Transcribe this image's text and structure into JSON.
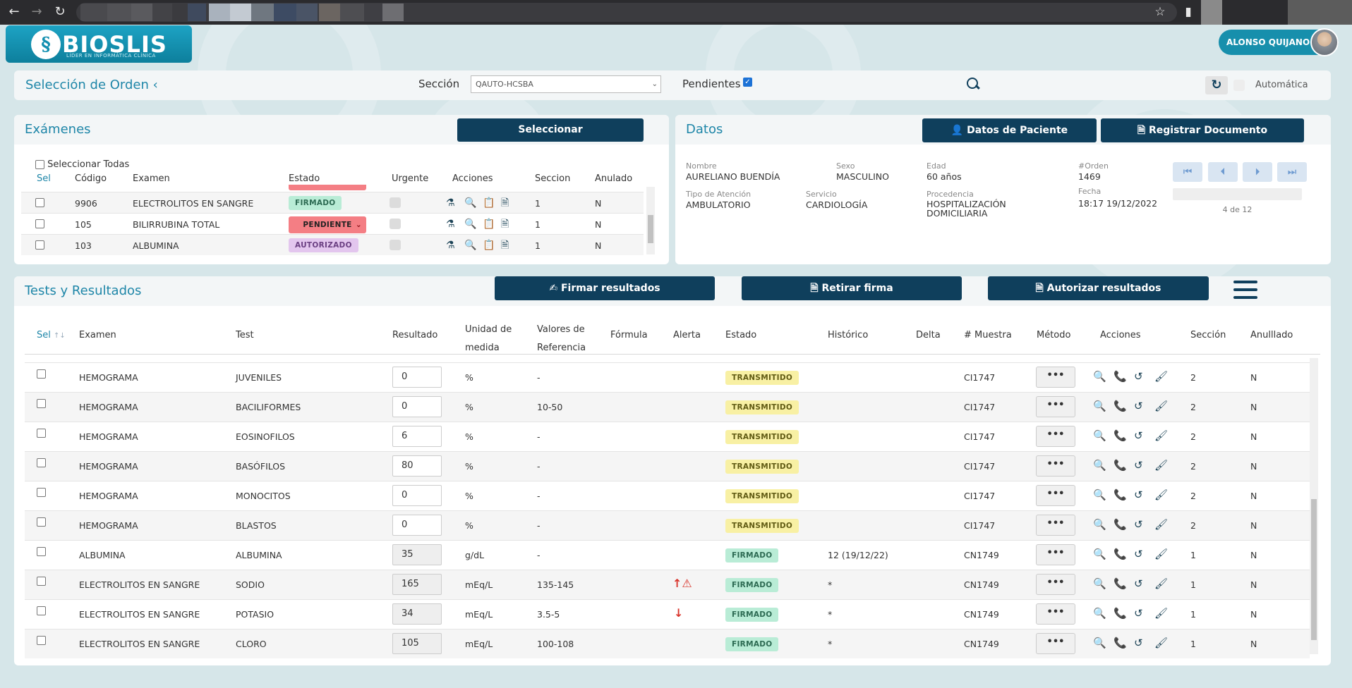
{
  "browser": {
    "back": "←",
    "forward": "→",
    "reload": "↻",
    "star": "☆",
    "sidepanel": "▮"
  },
  "header": {
    "logo_name": "BIOSLIS",
    "logo_tagline": "LÍDER EN INFORMÁTICA CLÍNICA",
    "user_name": "ALONSO QUIJANO"
  },
  "order_bar": {
    "title": "Selección de Orden",
    "section_label": "Sección",
    "section_value": "QAUTO-HCSBA",
    "pending_label": "Pendientes",
    "automatic_label": "Automática"
  },
  "exams": {
    "title": "Exámenes",
    "select_button": "Seleccionar",
    "select_all": "Seleccionar Todas",
    "columns": [
      "Sel",
      "Código",
      "Examen",
      "Estado",
      "Urgente",
      "Acciones",
      "Seccion",
      "Anulado"
    ],
    "rows": [
      {
        "codigo": "9906",
        "examen": "ELECTROLITOS EN SANGRE",
        "estado": "FIRMADO",
        "seccion": "1",
        "anulado": "N"
      },
      {
        "codigo": "105",
        "examen": "BILIRRUBINA TOTAL",
        "estado": "PENDIENTE",
        "seccion": "1",
        "anulado": "N"
      },
      {
        "codigo": "103",
        "examen": "ALBUMINA",
        "estado": "AUTORIZADO",
        "seccion": "1",
        "anulado": "N"
      }
    ]
  },
  "datos": {
    "title": "Datos",
    "patient_button": "Datos de Paciente",
    "register_button": "Registrar Documento",
    "nombre_label": "Nombre",
    "nombre": "AURELIANO BUENDÍA",
    "sexo_label": "Sexo",
    "sexo": "MASCULINO",
    "edad_label": "Edad",
    "edad": "60 años",
    "orden_label": "#Orden",
    "orden": "1469",
    "atencion_label": "Tipo de Atención",
    "atencion": "AMBULATORIO",
    "servicio_label": "Servicio",
    "servicio": "CARDIOLOGÍA",
    "procedencia_label": "Procedencia",
    "procedencia": "HOSPITALIZACIÓN DOMICILIARIA",
    "fecha_label": "Fecha",
    "fecha": "18:17 19/12/2022",
    "pager": "4 de 12"
  },
  "tests": {
    "title": "Tests y Resultados",
    "sign_button": "Firmar resultados",
    "remove_button": "Retirar firma",
    "authorize_button": "Autorizar resultados",
    "columns": {
      "sel": "Sel",
      "examen": "Examen",
      "test": "Test",
      "resultado": "Resultado",
      "unidad1": "Unidad de",
      "unidad2": "medida",
      "valores1": "Valores de",
      "valores2": "Referencia",
      "formula": "Fórmula",
      "alerta": "Alerta",
      "estado": "Estado",
      "historico": "Histórico",
      "delta": "Delta",
      "muestra": "# Muestra",
      "metodo": "Método",
      "acciones": "Acciones",
      "seccion": "Sección",
      "anulado": "Anulllado"
    },
    "rows": [
      {
        "examen": "HEMOGRAMA",
        "test": "JUVENILES",
        "resultado": "0",
        "unidad": "%",
        "ref": "-",
        "alerta": "",
        "estado": "TRANSMITIDO",
        "historico": "",
        "muestra": "CI1747",
        "metodo": "•••",
        "seccion": "2",
        "anulado": "N",
        "readonly": false
      },
      {
        "examen": "HEMOGRAMA",
        "test": "BACILIFORMES",
        "resultado": "0",
        "unidad": "%",
        "ref": "10-50",
        "alerta": "",
        "estado": "TRANSMITIDO",
        "historico": "",
        "muestra": "CI1747",
        "metodo": "•••",
        "seccion": "2",
        "anulado": "N",
        "readonly": false
      },
      {
        "examen": "HEMOGRAMA",
        "test": "EOSINOFILOS",
        "resultado": "6",
        "unidad": "%",
        "ref": "-",
        "alerta": "",
        "estado": "TRANSMITIDO",
        "historico": "",
        "muestra": "CI1747",
        "metodo": "•••",
        "seccion": "2",
        "anulado": "N",
        "readonly": false
      },
      {
        "examen": "HEMOGRAMA",
        "test": "BASÓFILOS",
        "resultado": "80",
        "unidad": "%",
        "ref": "-",
        "alerta": "",
        "estado": "TRANSMITIDO",
        "historico": "",
        "muestra": "CI1747",
        "metodo": "•••",
        "seccion": "2",
        "anulado": "N",
        "readonly": false
      },
      {
        "examen": "HEMOGRAMA",
        "test": "MONOCITOS",
        "resultado": "0",
        "unidad": "%",
        "ref": "-",
        "alerta": "",
        "estado": "TRANSMITIDO",
        "historico": "",
        "muestra": "CI1747",
        "metodo": "•••",
        "seccion": "2",
        "anulado": "N",
        "readonly": false
      },
      {
        "examen": "HEMOGRAMA",
        "test": "BLASTOS",
        "resultado": "0",
        "unidad": "%",
        "ref": "-",
        "alerta": "",
        "estado": "TRANSMITIDO",
        "historico": "",
        "muestra": "CI1747",
        "metodo": "•••",
        "seccion": "2",
        "anulado": "N",
        "readonly": false
      },
      {
        "examen": "ALBUMINA",
        "test": "ALBUMINA",
        "resultado": "35",
        "unidad": "g/dL",
        "ref": "-",
        "alerta": "",
        "estado": "FIRMADO",
        "historico": "12 (19/12/22)",
        "muestra": "CN1749",
        "metodo": "•••",
        "seccion": "1",
        "anulado": "N",
        "readonly": true
      },
      {
        "examen": "ELECTROLITOS EN SANGRE",
        "test": "SODIO",
        "resultado": "165",
        "unidad": "mEq/L",
        "ref": "135-145",
        "alerta": "high",
        "estado": "FIRMADO",
        "historico": "*",
        "muestra": "CN1749",
        "metodo": "•••",
        "seccion": "1",
        "anulado": "N",
        "readonly": true
      },
      {
        "examen": "ELECTROLITOS EN SANGRE",
        "test": "POTASIO",
        "resultado": "34",
        "unidad": "mEq/L",
        "ref": "3.5-5",
        "alerta": "low",
        "estado": "FIRMADO",
        "historico": "*",
        "muestra": "CN1749",
        "metodo": "•••",
        "seccion": "1",
        "anulado": "N",
        "readonly": true
      },
      {
        "examen": "ELECTROLITOS EN SANGRE",
        "test": "CLORO",
        "resultado": "105",
        "unidad": "mEq/L",
        "ref": "100-108",
        "alerta": "",
        "estado": "FIRMADO",
        "historico": "*",
        "muestra": "CN1749",
        "metodo": "•••",
        "seccion": "1",
        "anulado": "N",
        "readonly": true
      }
    ]
  },
  "colors": {
    "primary": "#1e86a8",
    "button": "#0f3f5c",
    "firmado": "#b9ecd6",
    "transmitido": "#f8f0a4",
    "autorizado": "#e3c6ee",
    "pendiente": "#f47e84",
    "alert": "#d9342b"
  }
}
